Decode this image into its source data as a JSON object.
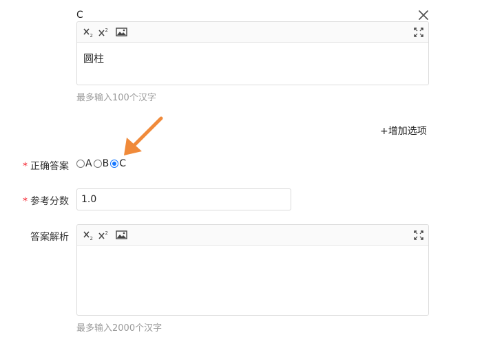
{
  "option": {
    "letter": "C",
    "content": "圆柱",
    "hint": "最多输入100个汉字"
  },
  "toolbar": {
    "subscript_icon": "subscript-icon",
    "superscript_icon": "superscript-icon",
    "image_icon": "image-icon",
    "fullscreen_icon": "fullscreen-icon"
  },
  "add_option_label": "+增加选项",
  "correct_answer": {
    "label": "正确答案",
    "required_mark": "*",
    "options": [
      "A",
      "B",
      "C"
    ],
    "selected": "C"
  },
  "score": {
    "label": "参考分数",
    "required_mark": "*",
    "value": "1.0"
  },
  "analysis": {
    "label": "答案解析",
    "content": "",
    "hint": "最多输入2000个汉字"
  },
  "colors": {
    "accent": "#1677ff",
    "required": "#f5222d",
    "arrow": "#f08a3a"
  }
}
